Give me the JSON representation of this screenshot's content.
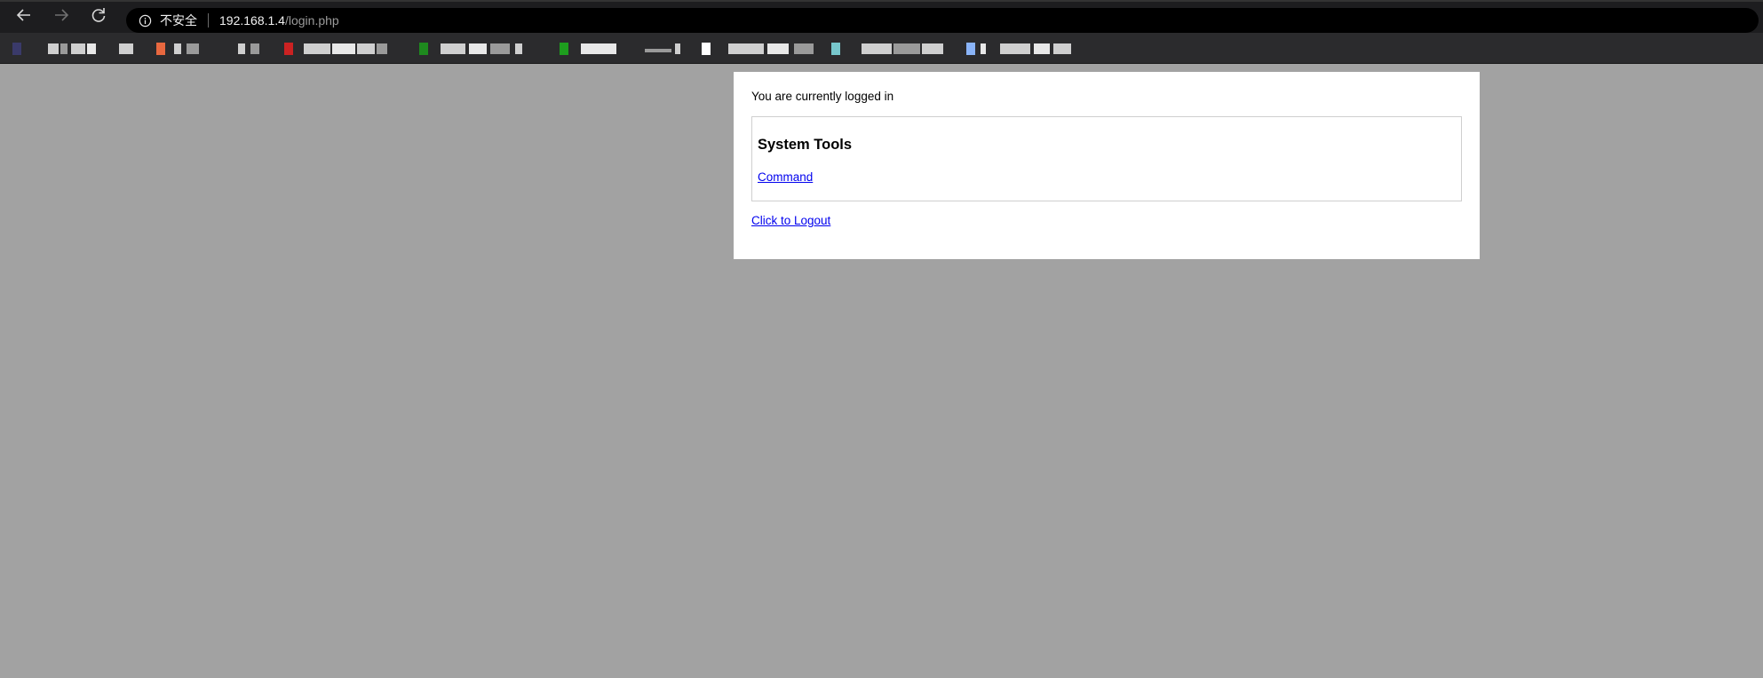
{
  "browser": {
    "security_label": "不安全",
    "url_host": "192.168.1.4",
    "url_path": "/login.php"
  },
  "icons": {
    "back": "back-arrow-icon",
    "forward": "forward-arrow-icon",
    "reload": "reload-icon",
    "info": "info-icon"
  },
  "colors": {
    "page_background": "#a2a2a2",
    "panel_background": "#ffffff",
    "link": "#0000ee",
    "toolbar": "#1d1d1f",
    "bookmarks_bar": "#2b2b2d"
  },
  "bookmarks": {
    "favicon_colors": [
      "#3a3a6a",
      "#e8683f",
      "#2b2b2d",
      "#cc2222",
      "#1e8a1e",
      "#1e9e1e",
      "#ffffff",
      "#77c7cc",
      "#8ab4f8"
    ]
  },
  "page": {
    "login_status": "You are currently logged in",
    "tools_heading": "System Tools",
    "command_link": "Command",
    "logout_link": "Click to Logout"
  }
}
